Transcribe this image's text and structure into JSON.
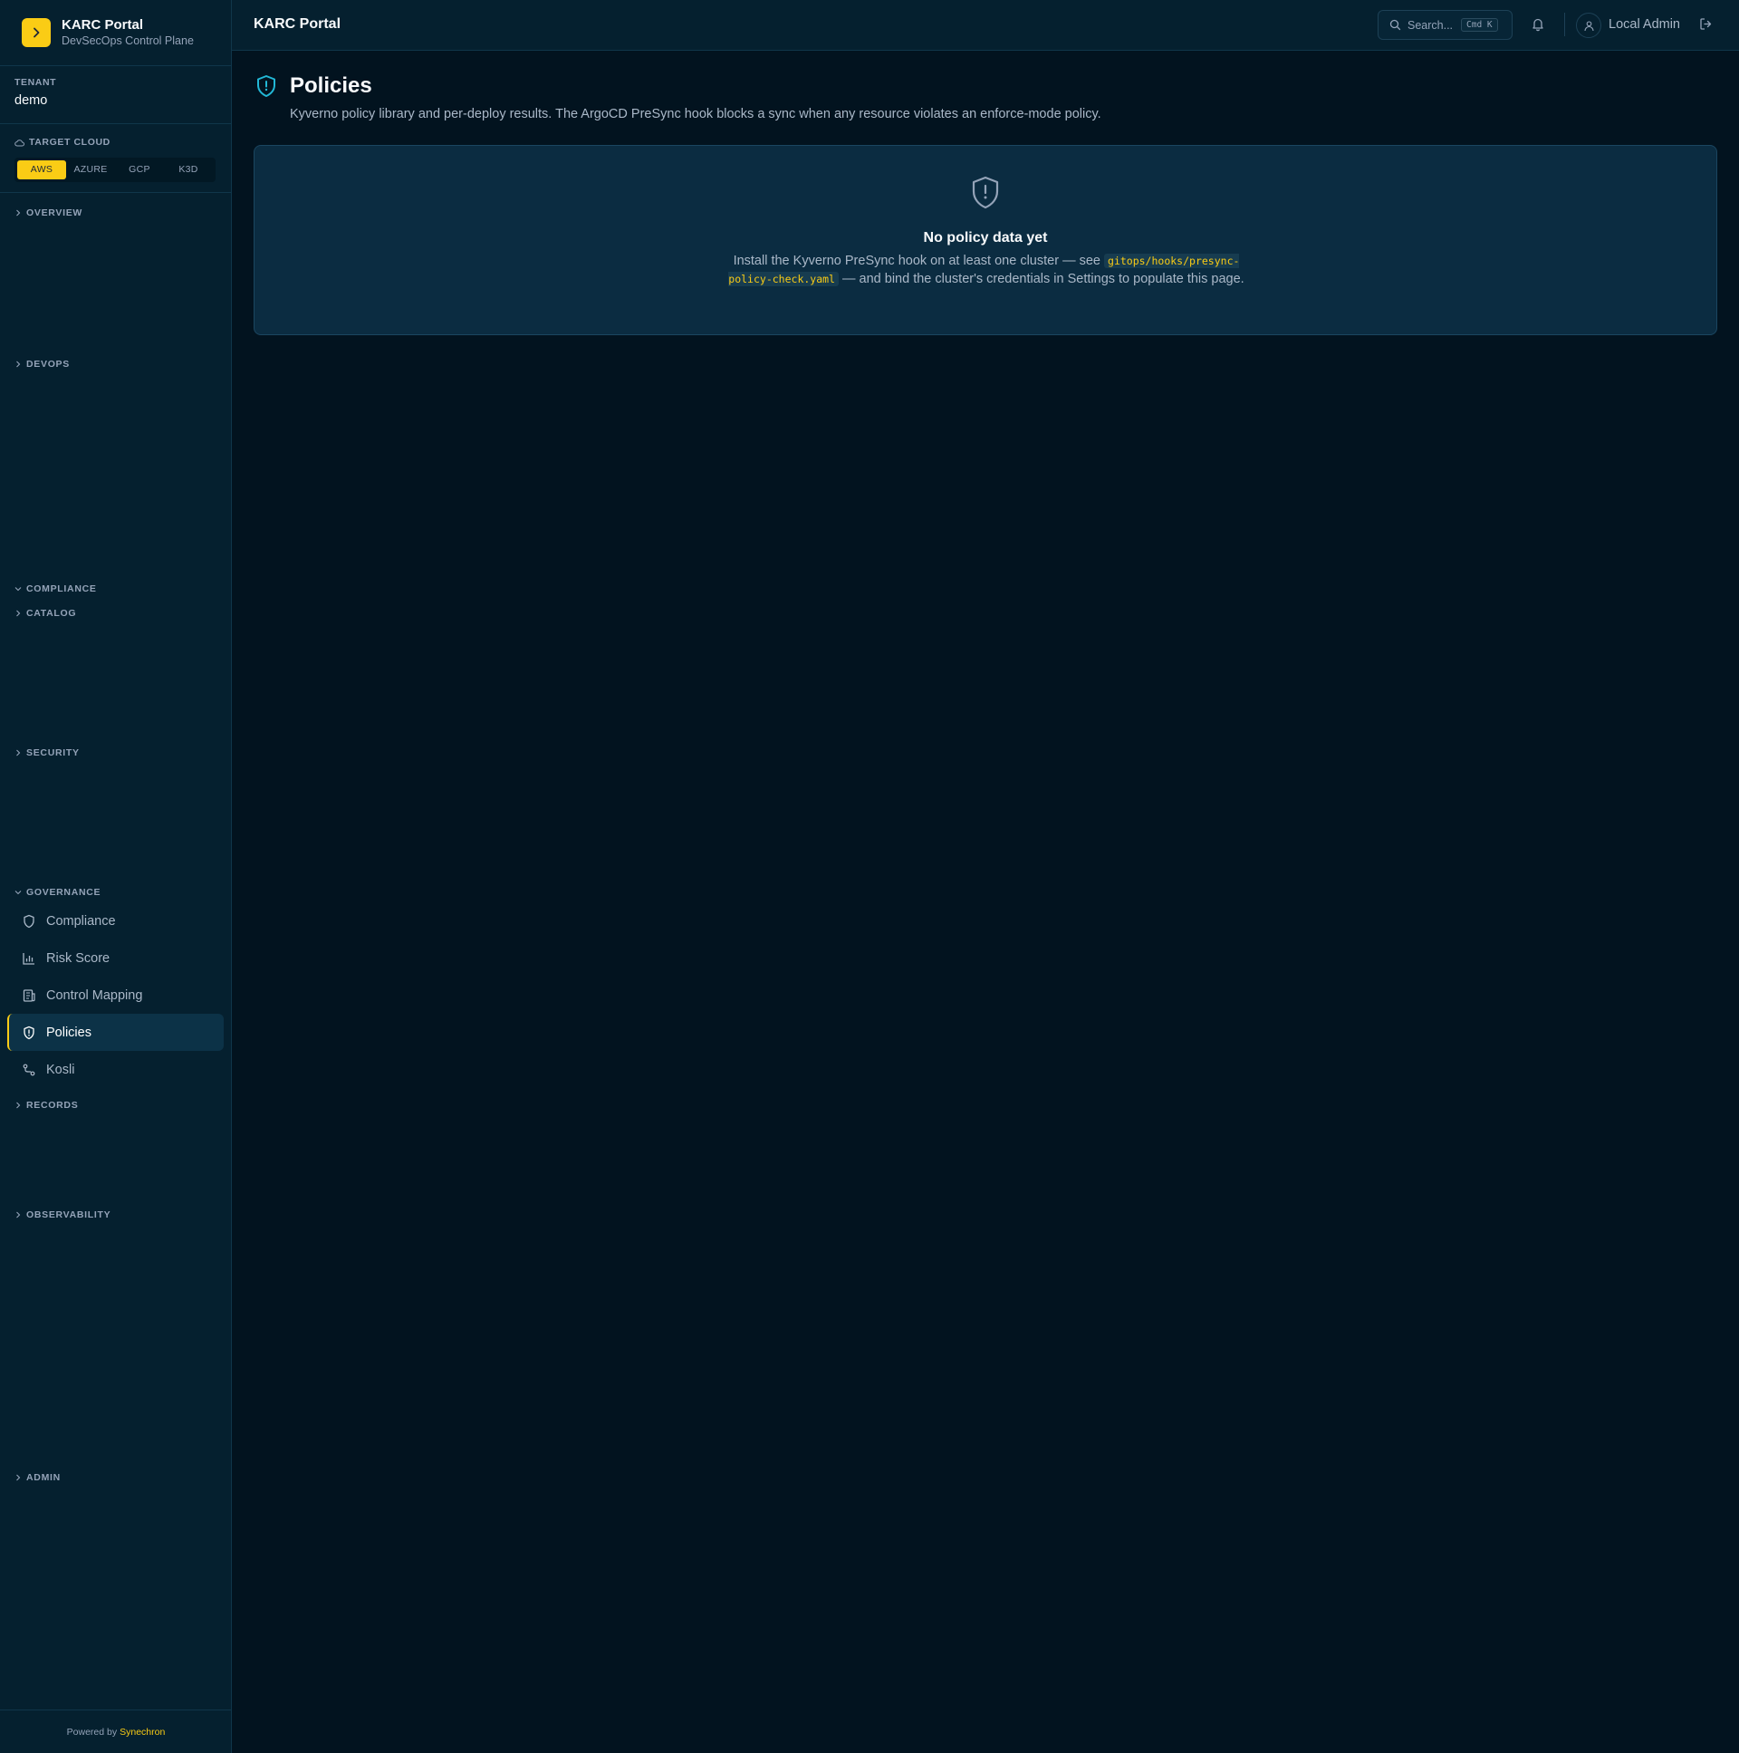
{
  "sidebar": {
    "brand_title": "KARC Portal",
    "brand_subtitle": "DevSecOps Control Plane",
    "tenant_label": "TENANT",
    "tenant_value": "demo",
    "cloud_label": "TARGET CLOUD",
    "cloud_options": [
      "AWS",
      "AZURE",
      "GCP",
      "K3D"
    ],
    "cloud_selected": "AWS",
    "sections": {
      "overview": "OVERVIEW",
      "devops": "DEVOPS",
      "compliance": "COMPLIANCE",
      "catalog": "CATALOG",
      "security": "SECURITY",
      "governance": "GOVERNANCE",
      "records": "RECORDS",
      "observability": "OBSERVABILITY",
      "admin": "ADMIN"
    },
    "governance_items": [
      "Compliance",
      "Risk Score",
      "Control Mapping",
      "Policies",
      "Kosli"
    ],
    "active_item": "Policies",
    "footer_text": "Powered by",
    "footer_link": "Synechron"
  },
  "header": {
    "title": "KARC Portal",
    "search_placeholder": "Search...",
    "search_shortcut": "Cmd K",
    "user_name": "Local Admin"
  },
  "main": {
    "title": "Policies",
    "description": "Kyverno policy library and per-deploy results. The ArgoCD PreSync hook blocks a sync when any resource violates an enforce-mode policy.",
    "empty": {
      "title": "No policy data yet",
      "text_before": "Install the Kyverno PreSync hook on at least one cluster — see",
      "code": "gitops/hooks/presync-policy-check.yaml",
      "text_after": "— and bind the cluster's credentials in Settings to populate this page."
    }
  },
  "colors": {
    "accent": "#facc15",
    "icon_accent": "#22b8d6",
    "sidebar_bg": "#05202f",
    "page_bg": "#02131f"
  }
}
